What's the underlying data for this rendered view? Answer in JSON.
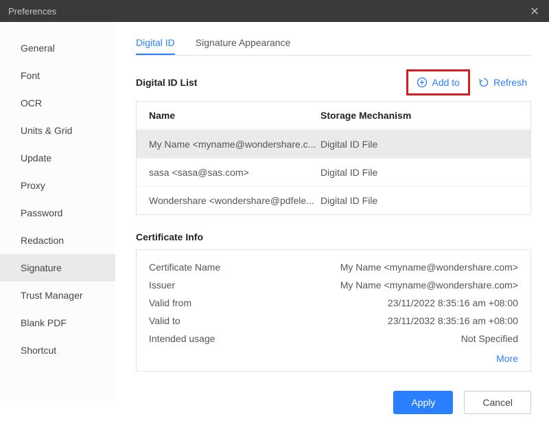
{
  "window": {
    "title": "Preferences"
  },
  "sidebar": {
    "items": [
      {
        "label": "General"
      },
      {
        "label": "Font"
      },
      {
        "label": "OCR"
      },
      {
        "label": "Units & Grid"
      },
      {
        "label": "Update"
      },
      {
        "label": "Proxy"
      },
      {
        "label": "Password"
      },
      {
        "label": "Redaction"
      },
      {
        "label": "Signature"
      },
      {
        "label": "Trust Manager"
      },
      {
        "label": "Blank PDF"
      },
      {
        "label": "Shortcut"
      }
    ],
    "selected_index": 8
  },
  "tabs": {
    "items": [
      {
        "label": "Digital ID"
      },
      {
        "label": "Signature Appearance"
      }
    ],
    "active_index": 0
  },
  "digital_id_list": {
    "title": "Digital ID List",
    "add_label": "Add to",
    "refresh_label": "Refresh",
    "columns": {
      "name": "Name",
      "storage": "Storage Mechanism"
    },
    "rows": [
      {
        "name": "My Name <myname@wondershare.c...",
        "storage": "Digital ID File"
      },
      {
        "name": "sasa <sasa@sas.com>",
        "storage": "Digital ID File"
      },
      {
        "name": "Wondershare <wondershare@pdfele...",
        "storage": "Digital ID File"
      }
    ],
    "selected_index": 0
  },
  "certificate_info": {
    "title": "Certificate Info",
    "rows": [
      {
        "label": "Certificate Name",
        "value": "My Name <myname@wondershare.com>"
      },
      {
        "label": "Issuer",
        "value": "My Name <myname@wondershare.com>"
      },
      {
        "label": "Valid from",
        "value": "23/11/2022 8:35:16 am +08:00"
      },
      {
        "label": "Valid to",
        "value": "23/11/2032 8:35:16 am +08:00"
      },
      {
        "label": "Intended usage",
        "value": "Not Specified"
      }
    ],
    "more_label": "More"
  },
  "footer": {
    "apply_label": "Apply",
    "cancel_label": "Cancel"
  }
}
